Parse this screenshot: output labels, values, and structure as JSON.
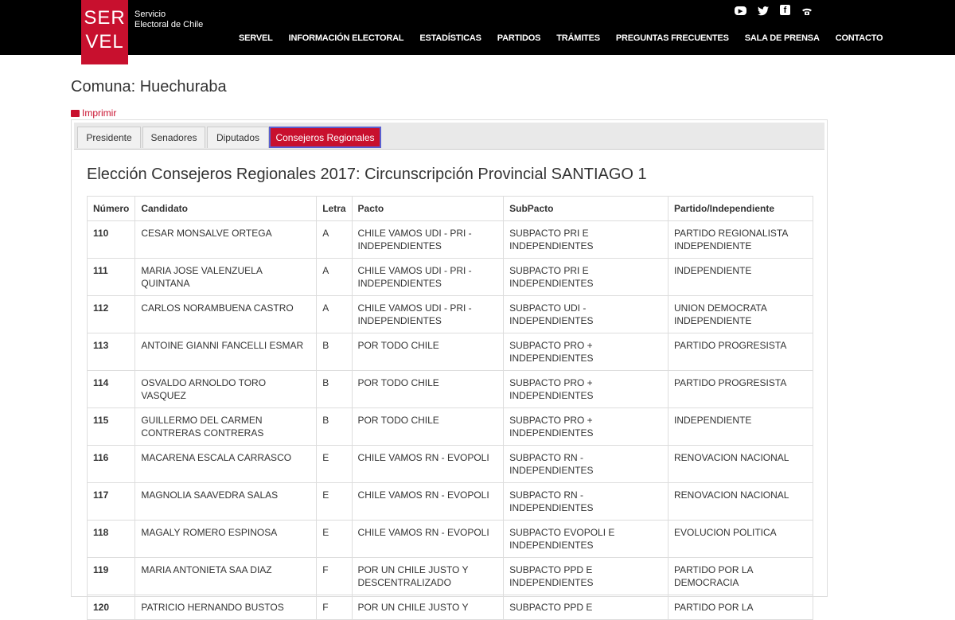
{
  "header": {
    "logo_top": "SER",
    "logo_bottom": "VEL",
    "subtitle_line1": "Servicio",
    "subtitle_line2": "Electoral de Chile",
    "nav": [
      "SERVEL",
      "INFORMACIÓN ELECTORAL",
      "ESTADÍSTICAS",
      "PARTIDOS",
      "TRÁMITES",
      "PREGUNTAS FRECUENTES",
      "SALA DE PRENSA",
      "CONTACTO"
    ],
    "social_icons": [
      "youtube-icon",
      "twitter-icon",
      "facebook-icon",
      "phone-icon"
    ]
  },
  "page": {
    "title": "Comuna: Huechuraba",
    "print_label": "Imprimir"
  },
  "tabs": [
    "Presidente",
    "Senadores",
    "Diputados",
    "Consejeros Regionales"
  ],
  "active_tab": "Consejeros Regionales",
  "section_title": "Elección Consejeros Regionales 2017: Circunscripción Provincial SANTIAGO 1",
  "table": {
    "columns": [
      "Número",
      "Candidato",
      "Letra",
      "Pacto",
      "SubPacto",
      "Partido/Independiente"
    ],
    "rows": [
      [
        "110",
        "CESAR MONSALVE ORTEGA",
        "A",
        "CHILE VAMOS UDI - PRI - INDEPENDIENTES",
        "SUBPACTO PRI E INDEPENDIENTES",
        "PARTIDO REGIONALISTA INDEPENDIENTE"
      ],
      [
        "111",
        "MARIA JOSE VALENZUELA QUINTANA",
        "A",
        "CHILE VAMOS UDI - PRI - INDEPENDIENTES",
        "SUBPACTO PRI E INDEPENDIENTES",
        "INDEPENDIENTE"
      ],
      [
        "112",
        "CARLOS NORAMBUENA CASTRO",
        "A",
        "CHILE VAMOS UDI - PRI - INDEPENDIENTES",
        "SUBPACTO UDI - INDEPENDIENTES",
        "UNION DEMOCRATA INDEPENDIENTE"
      ],
      [
        "113",
        "ANTOINE GIANNI FANCELLI ESMAR",
        "B",
        "POR TODO CHILE",
        "SUBPACTO PRO + INDEPENDIENTES",
        "PARTIDO PROGRESISTA"
      ],
      [
        "114",
        "OSVALDO ARNOLDO TORO VASQUEZ",
        "B",
        "POR TODO CHILE",
        "SUBPACTO PRO + INDEPENDIENTES",
        "PARTIDO PROGRESISTA"
      ],
      [
        "115",
        "GUILLERMO DEL CARMEN CONTRERAS CONTRERAS",
        "B",
        "POR TODO CHILE",
        "SUBPACTO PRO + INDEPENDIENTES",
        "INDEPENDIENTE"
      ],
      [
        "116",
        "MACARENA ESCALA CARRASCO",
        "E",
        "CHILE VAMOS RN - EVOPOLI",
        "SUBPACTO RN - INDEPENDIENTES",
        "RENOVACION NACIONAL"
      ],
      [
        "117",
        "MAGNOLIA SAAVEDRA SALAS",
        "E",
        "CHILE VAMOS RN - EVOPOLI",
        "SUBPACTO RN - INDEPENDIENTES",
        "RENOVACION NACIONAL"
      ],
      [
        "118",
        "MAGALY ROMERO ESPINOSA",
        "E",
        "CHILE VAMOS RN - EVOPOLI",
        "SUBPACTO EVOPOLI E INDEPENDIENTES",
        "EVOLUCION POLITICA"
      ],
      [
        "119",
        "MARIA ANTONIETA SAA DIAZ",
        "F",
        "POR UN CHILE JUSTO Y DESCENTRALIZADO",
        "SUBPACTO PPD E INDEPENDIENTES",
        "PARTIDO POR LA DEMOCRACIA"
      ],
      [
        "120",
        "PATRICIO HERNANDO BUSTOS",
        "F",
        "POR UN CHILE JUSTO Y",
        "SUBPACTO PPD E",
        "PARTIDO POR LA"
      ]
    ]
  },
  "colors": {
    "brand": "#c8102e",
    "header_bg": "#000000",
    "active_tab_border": "#5a5fcf"
  }
}
